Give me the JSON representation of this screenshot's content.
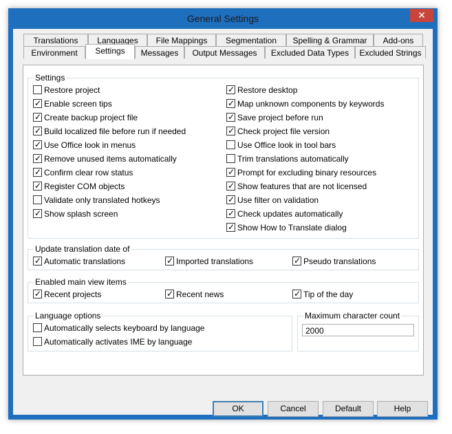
{
  "window": {
    "title": "General Settings",
    "close_glyph": "✕"
  },
  "tabs_row1": [
    {
      "label": "Translations"
    },
    {
      "label": "Languages"
    },
    {
      "label": "File Mappings"
    },
    {
      "label": "Segmentation"
    },
    {
      "label": "Spelling & Grammar"
    },
    {
      "label": "Add-ons"
    }
  ],
  "tabs_row2": [
    {
      "label": "Environment"
    },
    {
      "label": "Settings",
      "active": true
    },
    {
      "label": "Messages"
    },
    {
      "label": "Output Messages"
    },
    {
      "label": "Excluded Data Types"
    },
    {
      "label": "Excluded Strings"
    }
  ],
  "settings": {
    "label": "Settings",
    "left": [
      {
        "label": "Restore project",
        "checked": false
      },
      {
        "label": "Enable screen tips",
        "checked": true
      },
      {
        "label": "Create backup project file",
        "checked": true
      },
      {
        "label": "Build localized file before run if needed",
        "checked": true
      },
      {
        "label": "Use Office look in menus",
        "checked": true
      },
      {
        "label": "Remove unused items automatically",
        "checked": true
      },
      {
        "label": "Confirm clear row status",
        "checked": true
      },
      {
        "label": "Register COM objects",
        "checked": true
      },
      {
        "label": "Validate only translated hotkeys",
        "checked": false
      },
      {
        "label": "Show splash screen",
        "checked": true
      }
    ],
    "right": [
      {
        "label": "Restore desktop",
        "checked": true
      },
      {
        "label": "Map unknown components by keywords",
        "checked": true
      },
      {
        "label": "Save project before run",
        "checked": true
      },
      {
        "label": "Check project file version",
        "checked": true
      },
      {
        "label": "Use Office look in tool bars",
        "checked": false
      },
      {
        "label": "Trim translations automatically",
        "checked": false
      },
      {
        "label": "Prompt for excluding binary resources",
        "checked": true
      },
      {
        "label": "Show features that are not licensed",
        "checked": true
      },
      {
        "label": "Use filter on validation",
        "checked": true
      },
      {
        "label": "Check updates automatically",
        "checked": true
      },
      {
        "label": "Show How to Translate dialog",
        "checked": true
      }
    ]
  },
  "update_date": {
    "label": "Update translation date of",
    "items": [
      {
        "label": "Automatic translations",
        "checked": true
      },
      {
        "label": "Imported translations",
        "checked": true
      },
      {
        "label": "Pseudo translations",
        "checked": true
      }
    ]
  },
  "main_view": {
    "label": "Enabled main view items",
    "items": [
      {
        "label": "Recent projects",
        "checked": true
      },
      {
        "label": "Recent news",
        "checked": true
      },
      {
        "label": "Tip of the day",
        "checked": true
      }
    ]
  },
  "language_options": {
    "label": "Language options",
    "items": [
      {
        "label": "Automatically selects keyboard by language",
        "checked": false
      },
      {
        "label": "Automatically activates IME by language",
        "checked": false
      }
    ]
  },
  "max_char": {
    "label": "Maximum character count",
    "value": "2000"
  },
  "buttons": {
    "ok": "OK",
    "cancel": "Cancel",
    "default": "Default",
    "help": "Help"
  }
}
